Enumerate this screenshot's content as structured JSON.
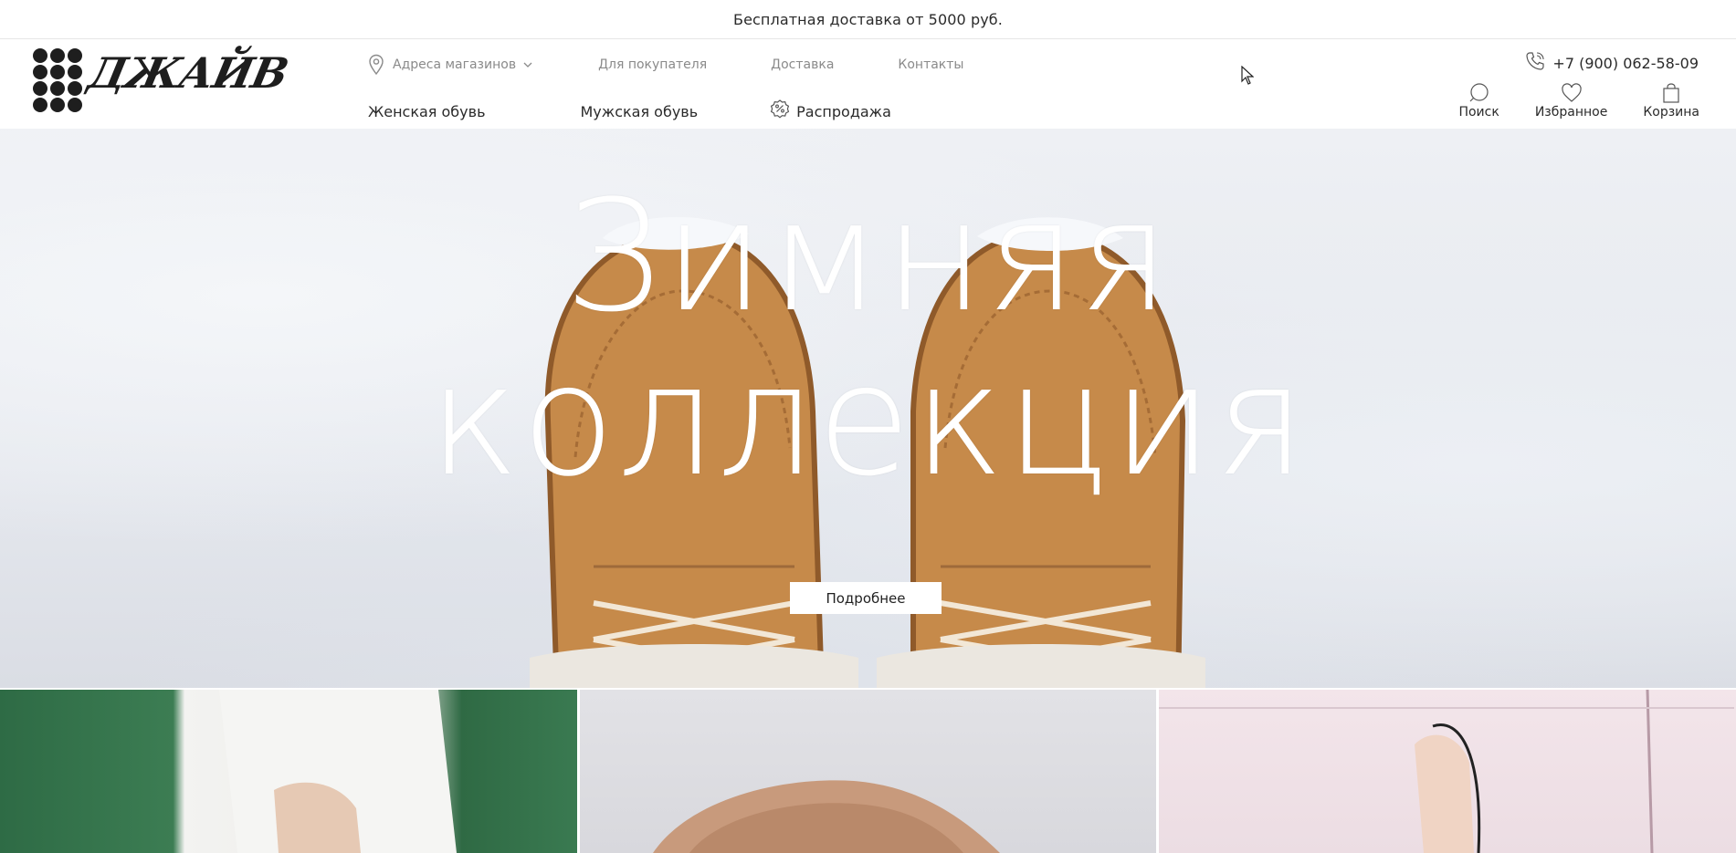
{
  "promo": {
    "text": "Бесплатная доставка от 5000 руб."
  },
  "logo": {
    "text": "ДЖАЙВ"
  },
  "nav_top": {
    "stores_label": "Адреса магазинов",
    "buyer_label": "Для покупателя",
    "delivery_label": "Доставка",
    "contacts_label": "Контакты"
  },
  "nav_main": {
    "women_label": "Женская обувь",
    "men_label": "Мужская обувь",
    "sale_label": "Распродажа"
  },
  "phone": {
    "number": "+7 (900) 062-58-09"
  },
  "actions": {
    "search_label": "Поиск",
    "favorites_label": "Избранное",
    "cart_label": "Корзина"
  },
  "hero": {
    "title_line1": "Зимняя",
    "title_line2": "коллекция",
    "button_label": "Подробнее"
  },
  "icons": [
    "map-pin-icon",
    "chevron-down-icon",
    "percent-badge-icon",
    "phone-icon",
    "search-icon",
    "heart-icon",
    "bag-icon"
  ],
  "colors": {
    "text": "#2a2a2a",
    "muted": "#8a8a8a",
    "boot": "#c68a4a",
    "snow": "#e8ebf0"
  }
}
